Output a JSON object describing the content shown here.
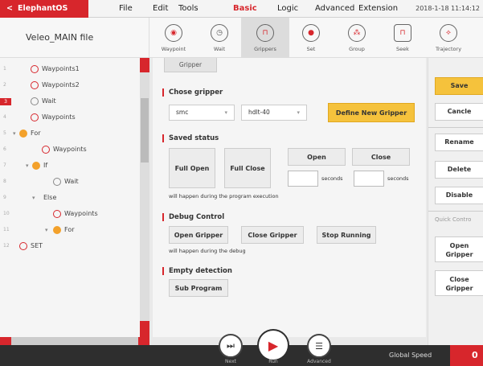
{
  "app": {
    "brand": "ElephantOS",
    "date": "2018-1-18 11:14:12"
  },
  "menu": [
    "File",
    "Edit",
    "Tools",
    "Basic",
    "Logic",
    "Advanced",
    "Extension"
  ],
  "file_title": "Veleo_MAIN file",
  "toolbar": [
    {
      "label": "Waypoint",
      "icon": "waypoint-icon"
    },
    {
      "label": "Wait",
      "icon": "clock-icon"
    },
    {
      "label": "Grippers",
      "icon": "gripper-icon"
    },
    {
      "label": "Set",
      "icon": "set-icon"
    },
    {
      "label": "Group",
      "icon": "group-icon"
    },
    {
      "label": "Seek",
      "icon": "seek-icon"
    },
    {
      "label": "Trajectory",
      "icon": "trajectory-icon"
    }
  ],
  "tree": [
    {
      "num": "1",
      "label": "Waypoints1"
    },
    {
      "num": "2",
      "label": "Waypoints2"
    },
    {
      "num": "3",
      "label": "Wait"
    },
    {
      "num": "4",
      "label": "Waypoints"
    },
    {
      "num": "5",
      "label": "For"
    },
    {
      "num": "6",
      "label": "Waypoints"
    },
    {
      "num": "7",
      "label": "If"
    },
    {
      "num": "8",
      "label": "Wait"
    },
    {
      "num": "9",
      "label": "Else"
    },
    {
      "num": "10",
      "label": "Waypoints"
    },
    {
      "num": "11",
      "label": "For"
    },
    {
      "num": "12",
      "label": "SET"
    }
  ],
  "main": {
    "tab": "Gripper",
    "chose_gripper": "Chose gripper",
    "select1": "smc",
    "select2": "hdlt-40",
    "define_new": "Define New Gripper",
    "saved_status": "Saved status",
    "full_open": "Full Open",
    "full_close": "Full Close",
    "open": "Open",
    "close": "Close",
    "seconds": "seconds",
    "note1": "will happen during the program execution",
    "debug_control": "Debug Control",
    "open_gripper": "Open Gripper",
    "close_gripper": "Close Gripper",
    "stop_running": "Stop Running",
    "note2": "will happen during the debug",
    "empty_detection": "Empty detection",
    "sub_program": "Sub Program"
  },
  "right": {
    "save": "Save",
    "cancle": "Cancle",
    "rename": "Rename",
    "delete": "Delete",
    "disable": "Disable",
    "quick_control": "Quick Contro",
    "open_gripper": "Open Gripper",
    "close_gripper": "Close Gripper"
  },
  "bottom": {
    "next": "Next",
    "run": "Run",
    "advanced": "Advanced",
    "global_speed": "Global Speed",
    "speed_value": "0"
  }
}
